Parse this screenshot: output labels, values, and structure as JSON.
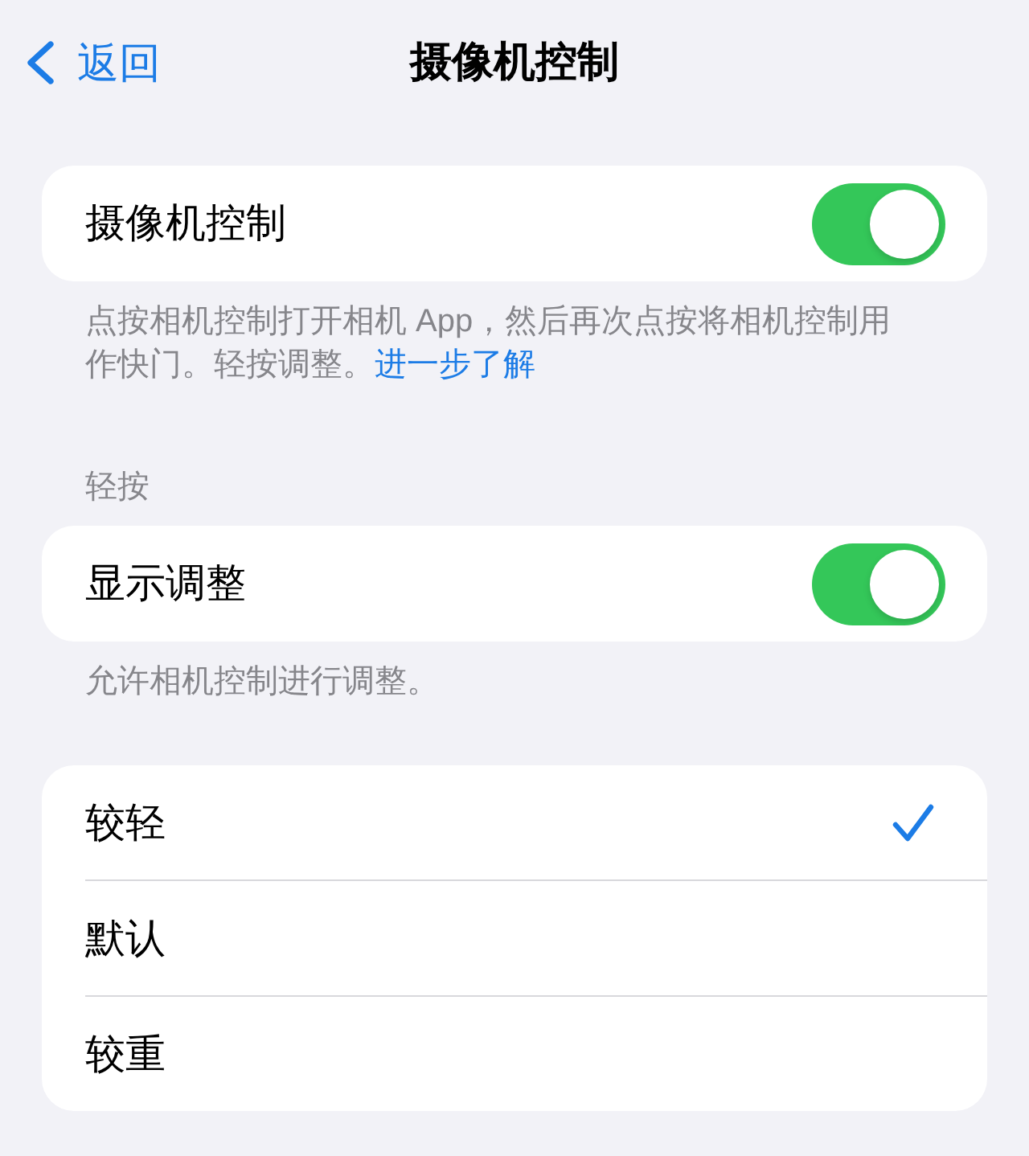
{
  "nav": {
    "back": "返回",
    "title": "摄像机控制"
  },
  "sections": [
    {
      "rows": [
        {
          "kind": "toggle",
          "label": "摄像机控制",
          "on": true
        }
      ],
      "footer": "点按相机控制打开相机 App，然后再次点按将相机控制用作快门。轻按调整。",
      "footer_link": "进一步了解"
    },
    {
      "header": "轻按",
      "rows": [
        {
          "kind": "toggle",
          "label": "显示调整",
          "on": true
        }
      ],
      "footer": "允许相机控制进行调整。"
    },
    {
      "rows": [
        {
          "kind": "check",
          "label": "较轻",
          "selected": true
        },
        {
          "kind": "check",
          "label": "默认",
          "selected": false
        },
        {
          "kind": "check",
          "label": "较重",
          "selected": false
        }
      ]
    }
  ]
}
